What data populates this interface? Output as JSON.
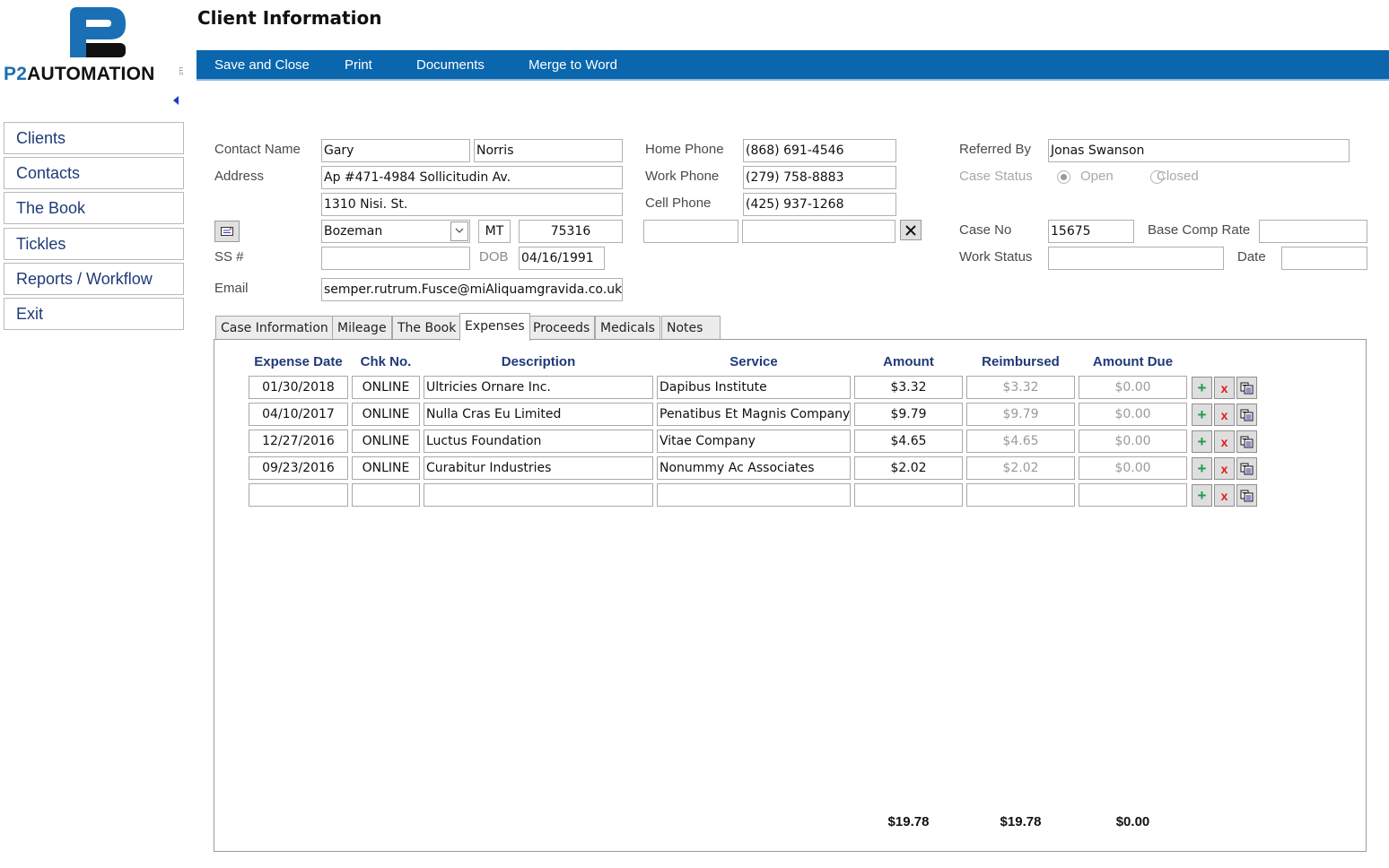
{
  "brand": {
    "logo_prefix": "P2",
    "logo_word": "AUTOMATION",
    "logo_suffix": "LLC",
    "primary_color": "#0a66ad",
    "accent_color": "#1b6fb5"
  },
  "page": {
    "title": "Client Information"
  },
  "toolbar": {
    "buttons": [
      {
        "label": "Save and Close"
      },
      {
        "label": "Print"
      },
      {
        "label": "Documents"
      },
      {
        "label": "Merge to Word"
      }
    ]
  },
  "sidebar": {
    "items": [
      {
        "label": "Clients"
      },
      {
        "label": "Contacts"
      },
      {
        "label": "The Book"
      },
      {
        "label": "Tickles"
      },
      {
        "label": "Reports / Workflow"
      },
      {
        "label": "Exit"
      }
    ]
  },
  "form": {
    "contact_name_label": "Contact Name",
    "first_name": "Gary",
    "last_name": "Norris",
    "address_label": "Address",
    "address_line1": "Ap #471-4984 Sollicitudin Av.",
    "address_line2": "1310 Nisi. St.",
    "city": "Bozeman",
    "state": "MT",
    "zip": "75316",
    "ss_label": "SS #",
    "ss_value": "",
    "dob_label": "DOB",
    "dob_value": "04/16/1991",
    "email_label": "Email",
    "email_value": "semper.rutrum.Fusce@miAliquamgravida.co.uk",
    "home_phone_label": "Home Phone",
    "home_phone": "(868) 691-4546",
    "work_phone_label": "Work Phone",
    "work_phone": "(279) 758-8883",
    "cell_phone_label": "Cell Phone",
    "cell_phone": "(425) 937-1268",
    "extra_phone_label_value": "",
    "extra_phone_value": "",
    "referred_by_label": "Referred By",
    "referred_by": "Jonas Swanson",
    "case_status_label": "Case Status",
    "case_status_options": [
      "Open",
      "Closed"
    ],
    "case_status_selected": "Open",
    "case_no_label": "Case No",
    "case_no": "15675",
    "base_comp_rate_label": "Base Comp Rate",
    "base_comp_rate": "",
    "work_status_label": "Work Status",
    "work_status": "",
    "date_label": "Date",
    "date_value": ""
  },
  "tabs": {
    "items": [
      {
        "label": "Case Information"
      },
      {
        "label": "Mileage"
      },
      {
        "label": "The Book"
      },
      {
        "label": "Expenses"
      },
      {
        "label": "Proceeds"
      },
      {
        "label": "Medicals"
      },
      {
        "label": "Notes"
      }
    ],
    "active": "Expenses"
  },
  "expenses": {
    "columns": [
      "Expense Date",
      "Chk No.",
      "Description",
      "Service",
      "Amount",
      "Reimbursed",
      "Amount Due"
    ],
    "rows": [
      {
        "date": "01/30/2018",
        "chk": "ONLINE",
        "description": "Ultricies Ornare Inc.",
        "service": "Dapibus Institute",
        "amount": "$3.32",
        "reimbursed": "$3.32",
        "due": "$0.00"
      },
      {
        "date": "04/10/2017",
        "chk": "ONLINE",
        "description": "Nulla Cras Eu Limited",
        "service": "Penatibus Et Magnis Company",
        "amount": "$9.79",
        "reimbursed": "$9.79",
        "due": "$0.00"
      },
      {
        "date": "12/27/2016",
        "chk": "ONLINE",
        "description": "Luctus Foundation",
        "service": "Vitae Company",
        "amount": "$4.65",
        "reimbursed": "$4.65",
        "due": "$0.00"
      },
      {
        "date": "09/23/2016",
        "chk": "ONLINE",
        "description": "Curabitur Industries",
        "service": "Nonummy Ac Associates",
        "amount": "$2.02",
        "reimbursed": "$2.02",
        "due": "$0.00"
      },
      {
        "date": "",
        "chk": "",
        "description": "",
        "service": "",
        "amount": "",
        "reimbursed": "",
        "due": ""
      }
    ],
    "row_actions": {
      "add": "+",
      "delete": "x",
      "copy": "copy-icon"
    },
    "totals": {
      "amount": "$19.78",
      "reimbursed": "$19.78",
      "due": "$0.00"
    }
  }
}
